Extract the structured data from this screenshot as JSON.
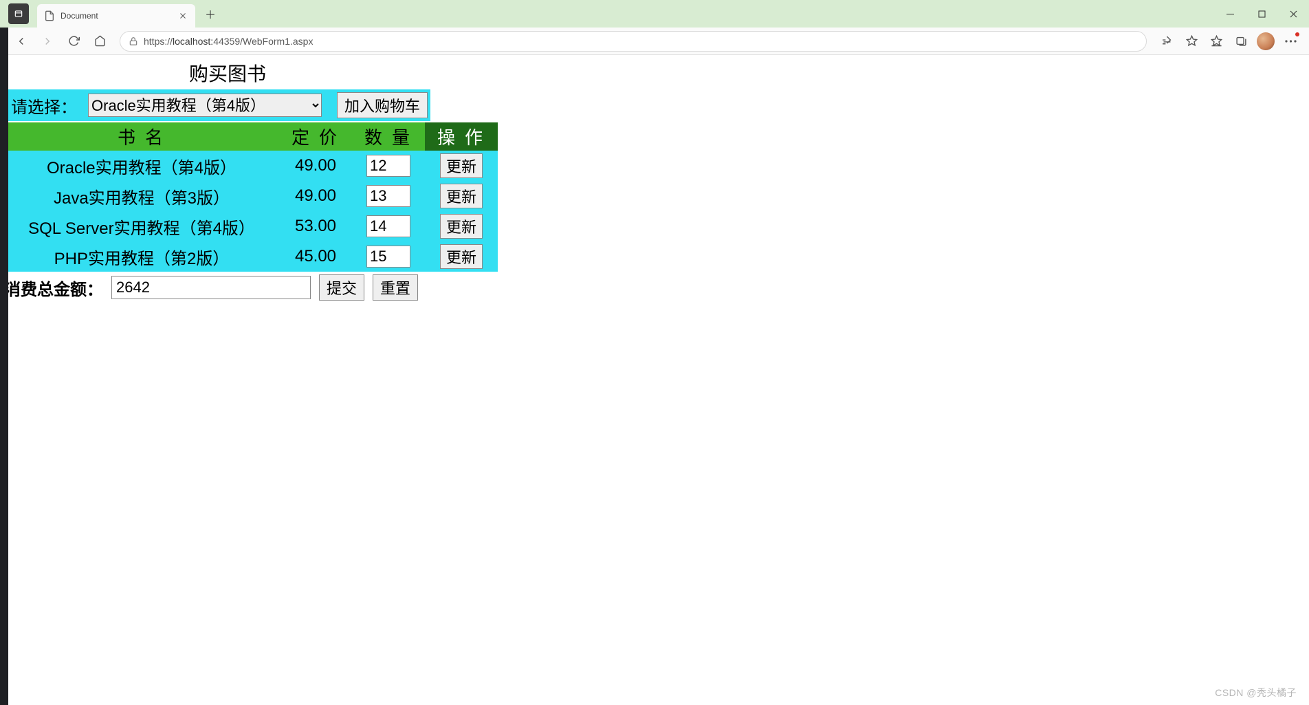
{
  "browser": {
    "tab_title": "Document",
    "url_prefix": "https://",
    "url_host": "localhost:",
    "url_port": "44359",
    "url_path": "/WebForm1.aspx"
  },
  "page": {
    "title": "购买图书",
    "select_label": "请选择：",
    "select_value": "Oracle实用教程（第4版）",
    "add_cart_label": "加入购物车",
    "headers": {
      "name": "书名",
      "price": "定价",
      "qty": "数量",
      "op": "操作"
    },
    "rows": [
      {
        "name": "Oracle实用教程（第4版）",
        "price": "49.00",
        "qty": "12",
        "op": "更新"
      },
      {
        "name": "Java实用教程（第3版）",
        "price": "49.00",
        "qty": "13",
        "op": "更新"
      },
      {
        "name": "SQL Server实用教程（第4版）",
        "price": "53.00",
        "qty": "14",
        "op": "更新"
      },
      {
        "name": "PHP实用教程（第2版）",
        "price": "45.00",
        "qty": "15",
        "op": "更新"
      }
    ],
    "total_label": "消费总金额：",
    "total_value": "2642",
    "submit_label": "提交",
    "reset_label": "重置"
  },
  "watermark": "CSDN @秃头橘子"
}
